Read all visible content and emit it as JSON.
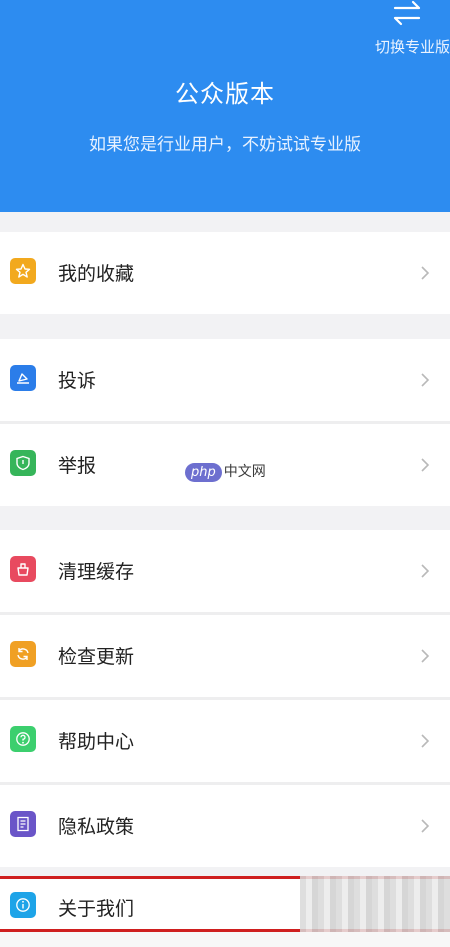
{
  "header": {
    "switch_label": "切换专业版",
    "title": "公众版本",
    "subtitle": "如果您是行业用户，不妨试试专业版",
    "bg_color": "#2d8cf0"
  },
  "menu": {
    "favorites": {
      "label": "我的收藏",
      "icon": "star-icon",
      "color": "#f2a91e"
    },
    "complaint": {
      "label": "投诉",
      "icon": "complaint-icon",
      "color": "#2b7de9"
    },
    "report": {
      "label": "举报",
      "icon": "shield-icon",
      "color": "#36b55a"
    },
    "clear_cache": {
      "label": "清理缓存",
      "icon": "broom-icon",
      "color": "#e84a5f"
    },
    "check_update": {
      "label": "检查更新",
      "icon": "refresh-icon",
      "color": "#f0a024"
    },
    "help": {
      "label": "帮助中心",
      "icon": "help-icon",
      "color": "#3ccf6e"
    },
    "privacy": {
      "label": "隐私政策",
      "icon": "document-icon",
      "color": "#6a55c8"
    },
    "about": {
      "label": "关于我们",
      "icon": "info-icon",
      "color": "#1ea4e8"
    }
  },
  "watermark": {
    "logo": "php",
    "text": "中文网"
  }
}
